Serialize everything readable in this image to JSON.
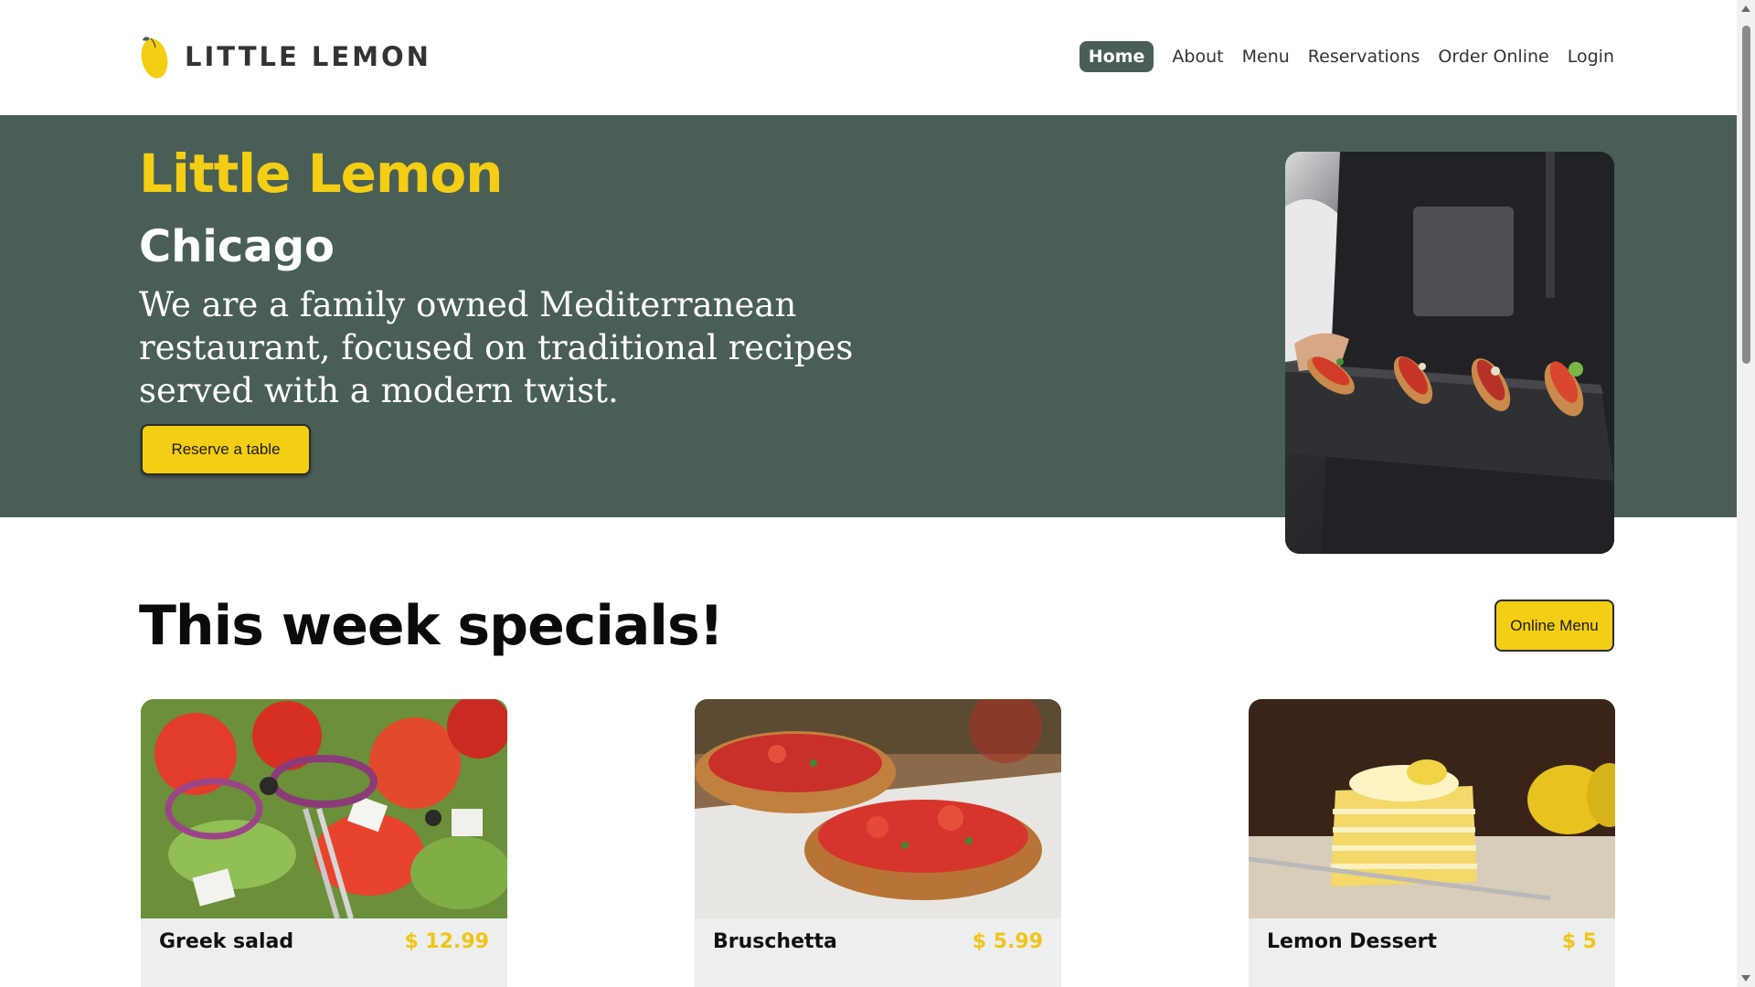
{
  "header": {
    "logo_text": "LITTLE LEMON",
    "nav": [
      {
        "label": "Home",
        "active": true
      },
      {
        "label": "About"
      },
      {
        "label": "Menu"
      },
      {
        "label": "Reservations"
      },
      {
        "label": "Order Online"
      },
      {
        "label": "Login"
      }
    ]
  },
  "hero": {
    "title": "Little Lemon",
    "subtitle": "Chicago",
    "description": "We are a family owned Mediterranean restaurant, focused on traditional recipes served with a modern twist.",
    "reserve_label": "Reserve a table"
  },
  "specials": {
    "title": "This week specials!",
    "menu_button_label": "Online Menu",
    "cards": [
      {
        "name": "Greek salad",
        "price": "$ 12.99"
      },
      {
        "name": "Bruschetta",
        "price": "$ 5.99"
      },
      {
        "name": "Lemon Dessert",
        "price": "$ 5"
      }
    ]
  },
  "colors": {
    "primary_green": "#495e57",
    "primary_yellow": "#f4ce14",
    "card_bg": "#edefee"
  }
}
